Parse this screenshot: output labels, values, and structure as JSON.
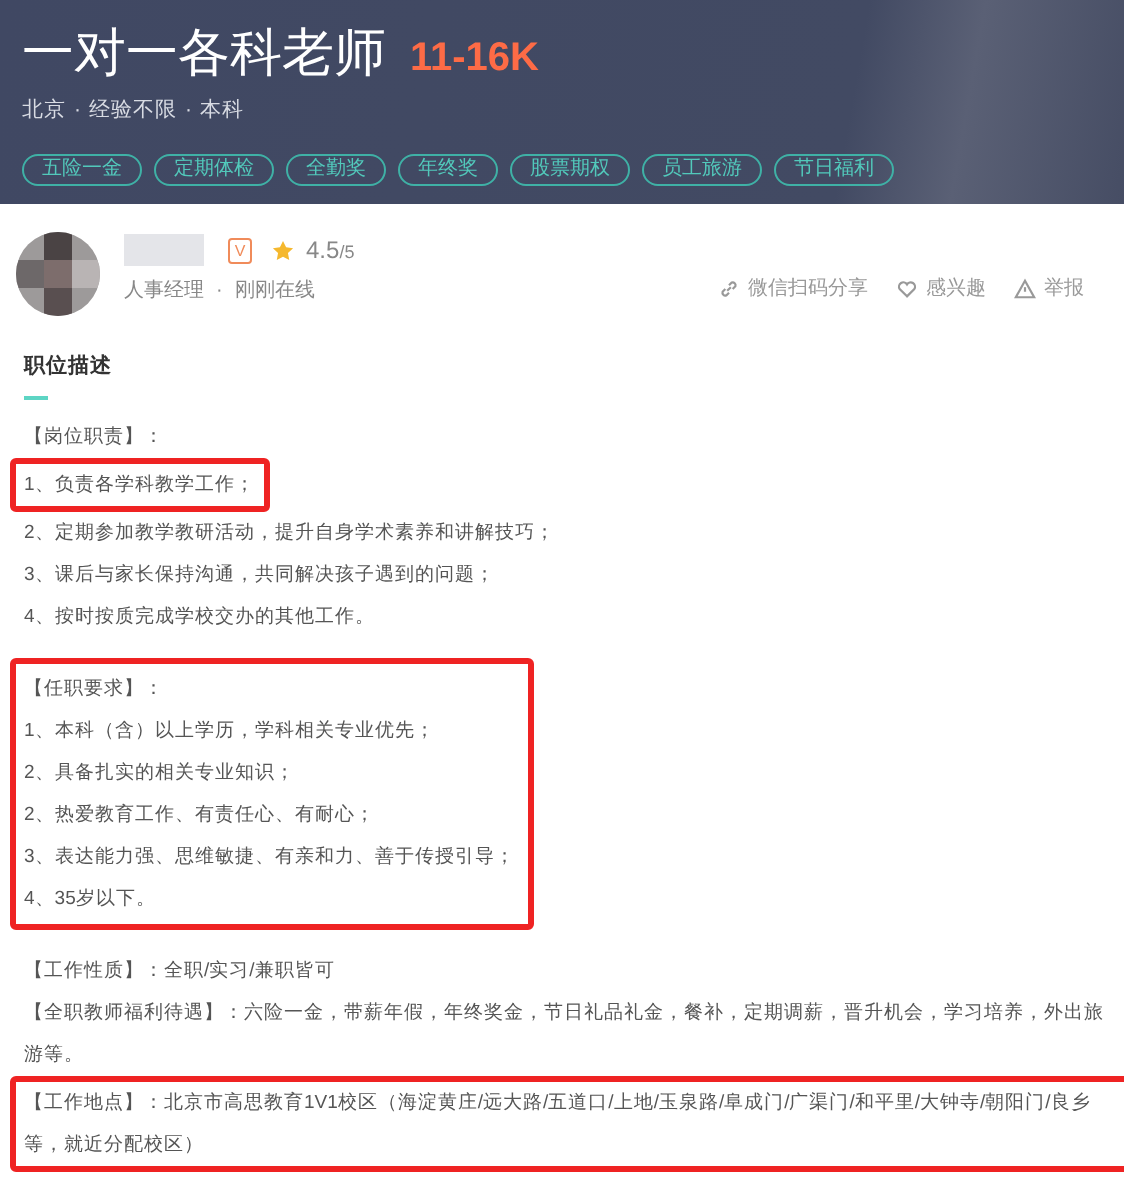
{
  "header": {
    "title": "一对一各科老师",
    "salary": "11-16K",
    "meta": [
      "北京",
      "经验不限",
      "本科"
    ],
    "meta_separator": "·",
    "tags": [
      "五险一金",
      "定期体检",
      "全勤奖",
      "年终奖",
      "股票期权",
      "员工旅游",
      "节日福利"
    ]
  },
  "recruiter": {
    "verified_badge": "V",
    "rating": "4.5",
    "rating_max": "/5",
    "role": "人事经理",
    "separator": "·",
    "status": "刚刚在线"
  },
  "actions": [
    {
      "kind": "share",
      "label": "微信扫码分享"
    },
    {
      "kind": "like",
      "label": "感兴趣"
    },
    {
      "kind": "report",
      "label": "举报"
    }
  ],
  "section_title": "职位描述",
  "groups": [
    {
      "outlined": false,
      "lines": [
        "【岗位职责】："
      ]
    },
    {
      "outlined": true,
      "lines": [
        "1、负责各学科教学工作；"
      ]
    },
    {
      "outlined": false,
      "lines": [
        "2、定期参加教学教研活动，提升自身学术素养和讲解技巧；",
        "3、课后与家长保持沟通，共同解决孩子遇到的问题；",
        "4、按时按质完成学校交办的其他工作。"
      ]
    },
    {
      "outlined": true,
      "gap_before": true,
      "lines": [
        "【任职要求】：",
        "1、本科（含）以上学历，学科相关专业优先；",
        "2、具备扎实的相关专业知识；",
        "2、热爱教育工作、有责任心、有耐心；",
        "3、表达能力强、思维敏捷、有亲和力、善于传授引导；",
        "4、35岁以下。"
      ]
    },
    {
      "outlined": false,
      "gap_before": true,
      "lines": [
        "【工作性质】：全职/实习/兼职皆可",
        "【全职教师福利待遇】：六险一金，带薪年假，年终奖金，节日礼品礼金，餐补，定期调薪，晋升机会，学习培养，外出旅游等。"
      ]
    },
    {
      "outlined": true,
      "lines": [
        "【工作地点】：北京市高思教育1V1校区（海淀黄庄/远大路/五道口/上地/玉泉路/阜成门/广渠门/和平里/大钟寺/朝阳门/良乡等，就近分配校区）"
      ]
    }
  ]
}
